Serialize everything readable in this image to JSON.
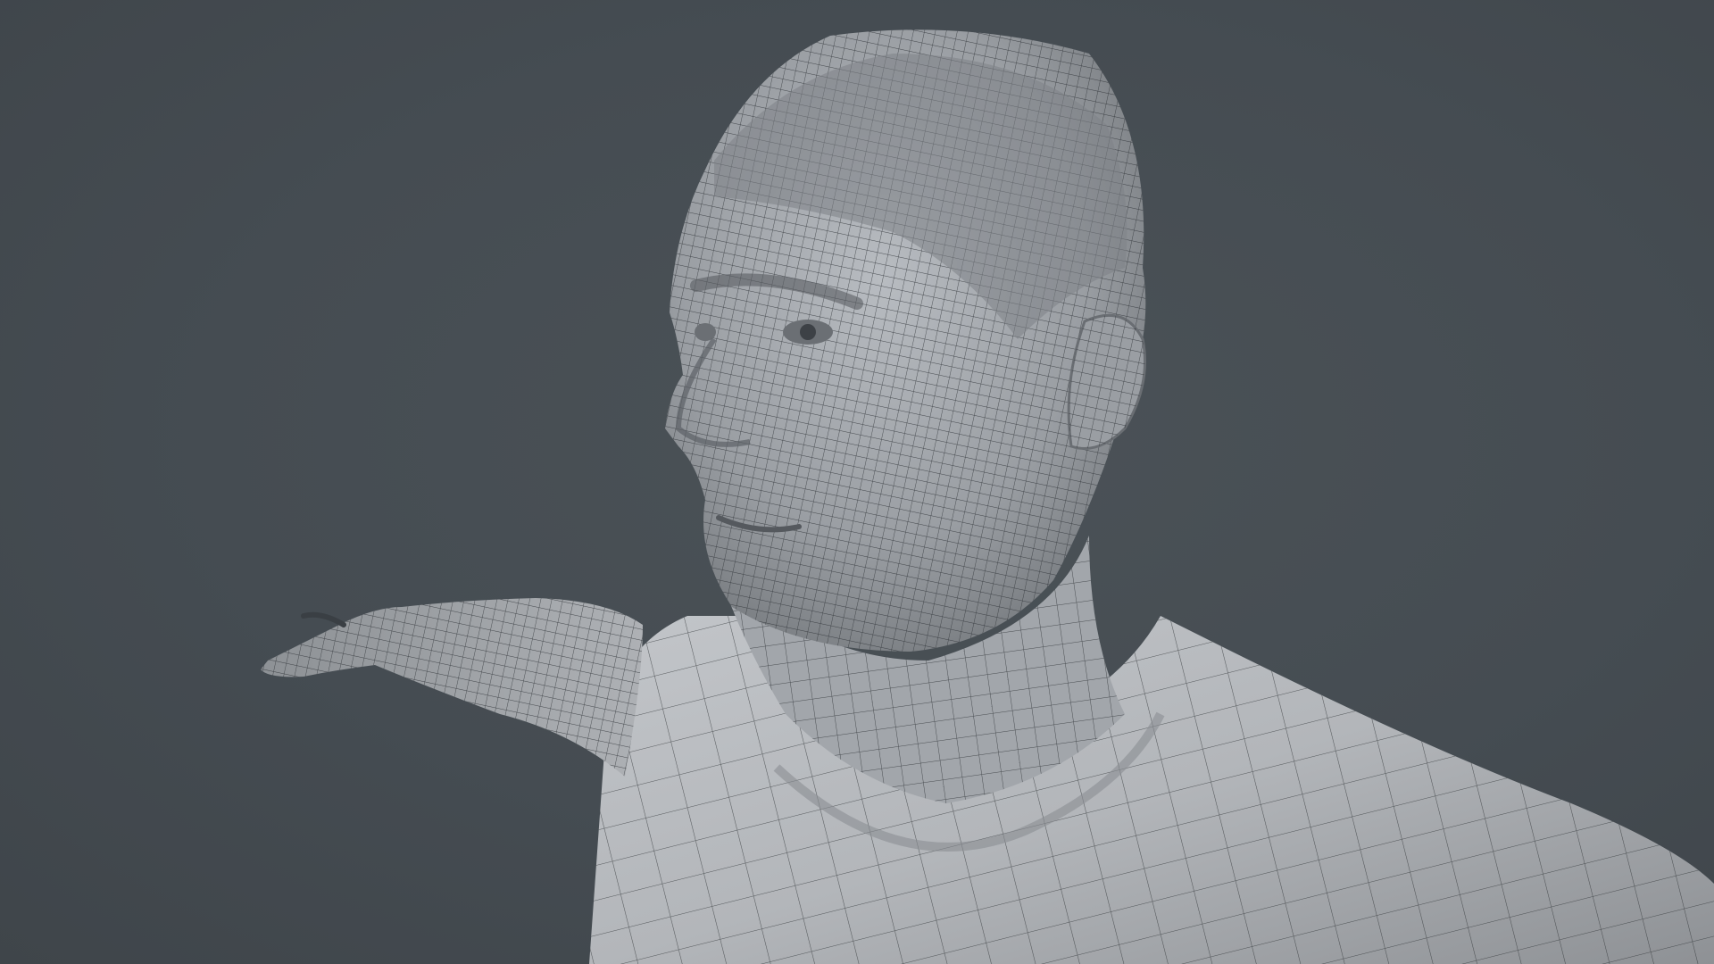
{
  "viewport": {
    "background_color": "#454c52",
    "subject": "wireframe-mesh-male-head-and-torso",
    "mesh_surface_color": "#a7abb0",
    "mesh_line_color": "#2c3034"
  }
}
